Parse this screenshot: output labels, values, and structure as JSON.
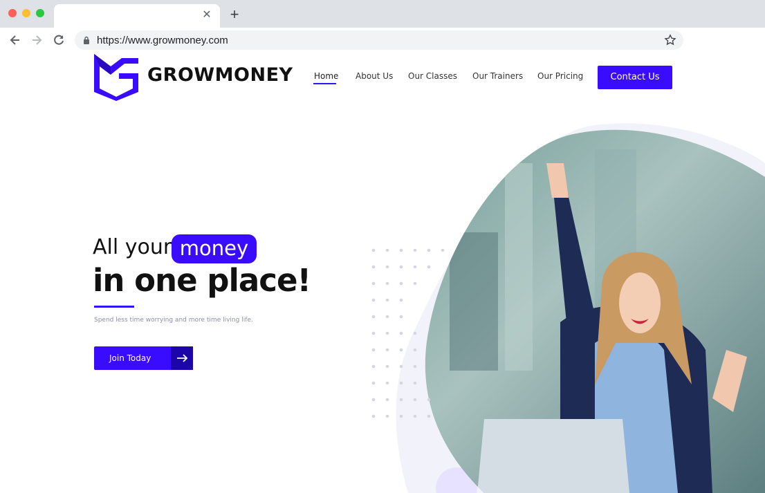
{
  "browser": {
    "url": "https://www.growmoney.com",
    "new_tab_glyph": "+",
    "close_glyph": "✕"
  },
  "icons": {
    "back": "back-arrow-icon",
    "forward": "forward-arrow-icon",
    "reload": "reload-icon",
    "lock": "lock-icon",
    "bookmark": "star-icon",
    "extension": "extension-icon",
    "profile": "profile-icon",
    "menu": "kebab-menu-icon"
  },
  "site": {
    "brand": "GROWMONEY",
    "nav": {
      "home": "Home",
      "about": "About Us",
      "classes": "Our Classes",
      "trainers": "Our Trainers",
      "pricing": "Our Pricing"
    },
    "contact_label": "Contact Us",
    "hero": {
      "line1": "All your",
      "highlight": "money",
      "line2": "in one place!",
      "tagline": "Spend less time worrying and more time living life.",
      "cta": "Join Today"
    }
  },
  "colors": {
    "accent": "#3a0cff",
    "accent_dark": "#1c06a8",
    "text": "#111111",
    "muted": "#8a8fa8",
    "chrome_bg": "#dee1e6"
  }
}
